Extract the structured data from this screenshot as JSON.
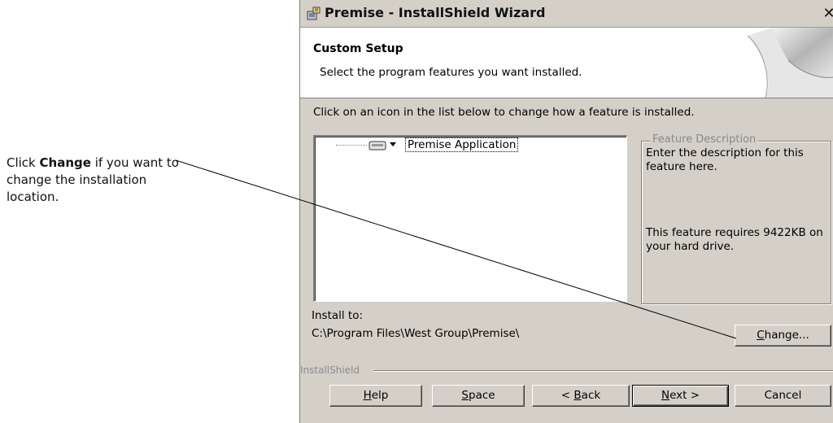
{
  "callout": {
    "prefix": "Click ",
    "keyword": "Change",
    "suffix": " if you want to change the installation location."
  },
  "window": {
    "title": "Premise - InstallShield Wizard",
    "close_symbol": "✕"
  },
  "header": {
    "title": "Custom Setup",
    "subtitle": "Select the program features you want installed."
  },
  "instruction": "Click on an icon in the list below to change how a feature is installed.",
  "feature_tree": {
    "items": [
      {
        "label": "Premise Application",
        "icon": "hard-drive-icon"
      }
    ]
  },
  "feature_description": {
    "legend": "Feature Description",
    "text": "Enter the description for this feature here.",
    "requirement": "This feature requires 9422KB on your hard drive."
  },
  "install_to": {
    "label": "Install to:",
    "path": "C:\\Program Files\\West Group\\Premise\\"
  },
  "buttons": {
    "change": {
      "accel": "C",
      "rest": "hange..."
    },
    "help": {
      "accel": "H",
      "rest": "elp"
    },
    "space": {
      "accel": "S",
      "rest": "pace"
    },
    "back": {
      "pre": "< ",
      "accel": "B",
      "rest": "ack"
    },
    "next": {
      "accel": "N",
      "rest": "ext >"
    },
    "cancel": {
      "label": "Cancel"
    }
  },
  "branding": "InstallShield",
  "colors": {
    "dialog_bg": "#d4d0c8",
    "header_bg": "#ffffff",
    "shadow": "#808080"
  }
}
